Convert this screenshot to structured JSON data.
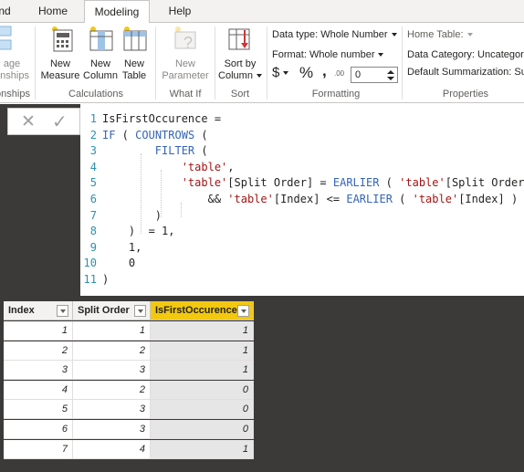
{
  "tabs": [
    "nd",
    "Home",
    "Modeling",
    "Help"
  ],
  "ribbon": {
    "relationships": {
      "label_line1": "age",
      "label_line2": "onships",
      "group": "onships"
    },
    "calculations": {
      "group": "Calculations",
      "new_measure": [
        "New",
        "Measure"
      ],
      "new_column": [
        "New",
        "Column"
      ],
      "new_table": [
        "New",
        "Table"
      ]
    },
    "whatif": {
      "group": "What If",
      "new_parameter": [
        "New",
        "Parameter"
      ]
    },
    "sort": {
      "group": "Sort",
      "sort_by_column": [
        "Sort by",
        "Column"
      ]
    },
    "formatting": {
      "group": "Formatting",
      "data_type": "Data type: Whole Number",
      "format": "Format: Whole number",
      "currency": "$",
      "percent": "%",
      "comma": ",",
      "decimals_icon": ".00",
      "decimals_value": "0"
    },
    "properties": {
      "group": "Properties",
      "home_table": "Home Table:",
      "data_category": "Data Category: Uncategoriz",
      "default_summarization": "Default Summarization: Sum"
    }
  },
  "formula": {
    "cancel_icon": "✕",
    "commit_icon": "✓",
    "lines": [
      {
        "n": "1",
        "parts": [
          [
            "",
            "IsFirstOccurence ="
          ]
        ]
      },
      {
        "n": "2",
        "parts": [
          [
            "kw",
            "IF"
          ],
          [
            "",
            " ( "
          ],
          [
            "kw",
            "COUNTROWS"
          ],
          [
            "",
            " ("
          ]
        ]
      },
      {
        "n": "3",
        "parts": [
          [
            "",
            "        "
          ],
          [
            "kw",
            "FILTER"
          ],
          [
            "",
            " ("
          ]
        ]
      },
      {
        "n": "4",
        "parts": [
          [
            "",
            "            "
          ],
          [
            "str",
            "'table'"
          ],
          [
            "",
            ","
          ]
        ]
      },
      {
        "n": "5",
        "parts": [
          [
            "",
            "            "
          ],
          [
            "str",
            "'table'"
          ],
          [
            "",
            "[Split Order] = "
          ],
          [
            "kw",
            "EARLIER"
          ],
          [
            "",
            " ( "
          ],
          [
            "str",
            "'table'"
          ],
          [
            "",
            "[Split Order] )"
          ]
        ]
      },
      {
        "n": "6",
        "parts": [
          [
            "",
            "                && "
          ],
          [
            "str",
            "'table'"
          ],
          [
            "",
            "[Index] <= "
          ],
          [
            "kw",
            "EARLIER"
          ],
          [
            "",
            " ( "
          ],
          [
            "str",
            "'table'"
          ],
          [
            "",
            "[Index] )"
          ]
        ]
      },
      {
        "n": "7",
        "parts": [
          [
            "",
            "        )"
          ]
        ]
      },
      {
        "n": "8",
        "parts": [
          [
            "",
            "    )  = 1,"
          ]
        ]
      },
      {
        "n": "9",
        "parts": [
          [
            "",
            "    1,"
          ]
        ]
      },
      {
        "n": "10",
        "parts": [
          [
            "",
            "    0"
          ]
        ]
      },
      {
        "n": "11",
        "parts": [
          [
            "",
            ")"
          ]
        ]
      }
    ]
  },
  "table": {
    "columns": [
      "Index",
      "Split Order",
      "IsFirstOccurence"
    ],
    "rows": [
      [
        "1",
        "1",
        "1"
      ],
      [
        "2",
        "2",
        "1"
      ],
      [
        "3",
        "3",
        "1"
      ],
      [
        "4",
        "2",
        "0"
      ],
      [
        "5",
        "3",
        "0"
      ],
      [
        "6",
        "3",
        "0"
      ],
      [
        "7",
        "4",
        "1"
      ]
    ]
  },
  "colors": {
    "accent_yellow": "#f2c811",
    "dark_canvas": "#3b3a39",
    "dax_keyword": "#3565b8",
    "dax_string": "#a31515",
    "line_number": "#2b91af"
  }
}
